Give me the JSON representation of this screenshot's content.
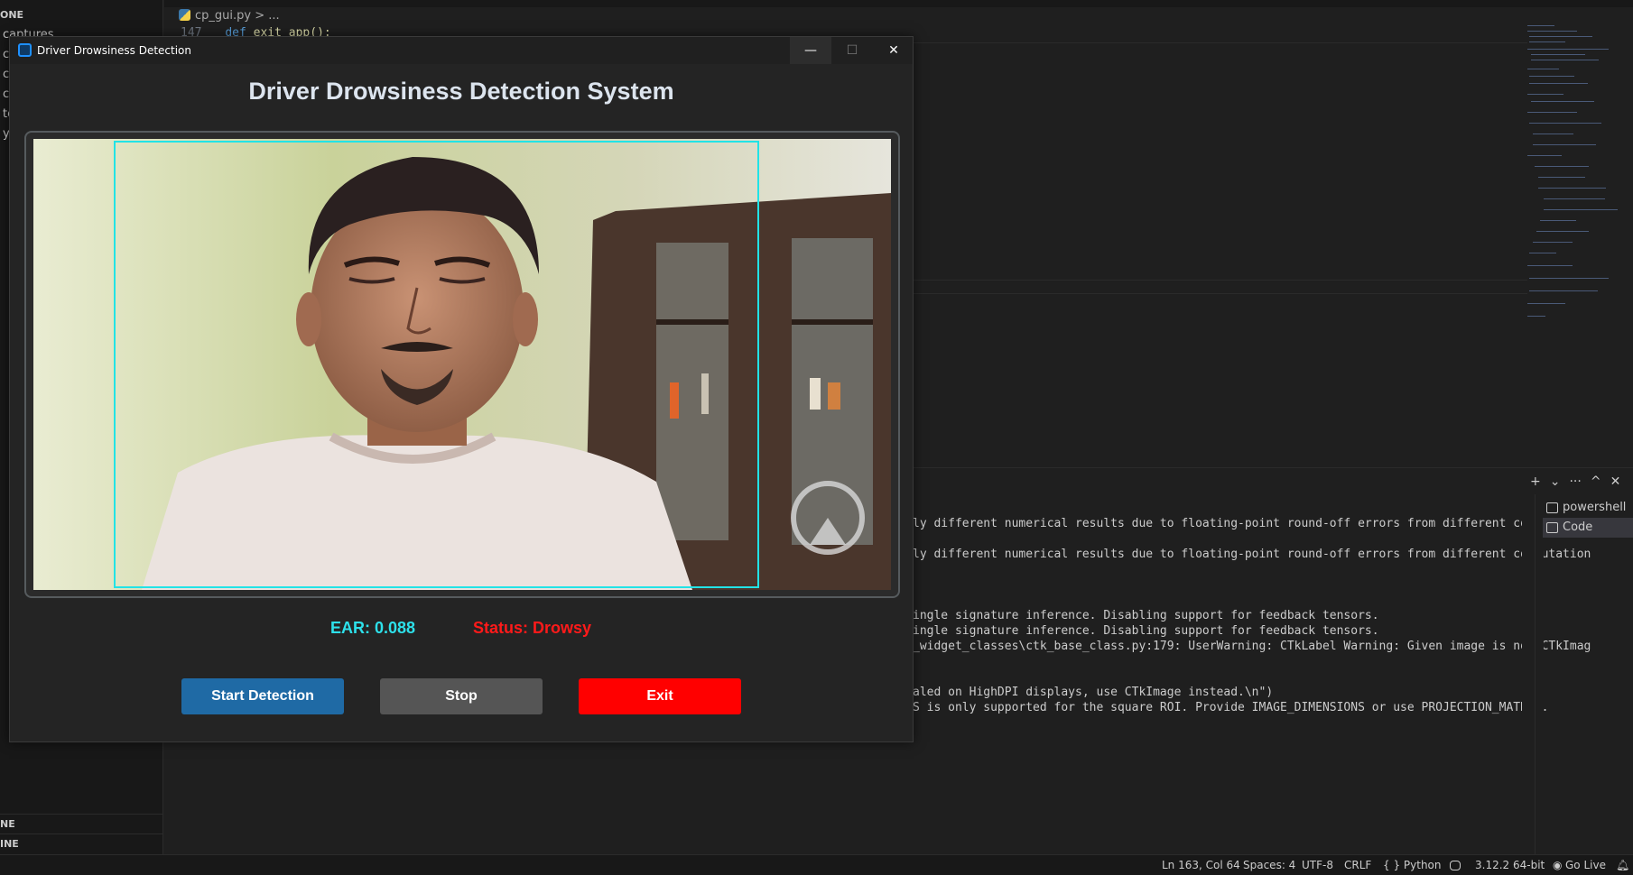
{
  "vscode": {
    "explorer": {
      "section_top": "ONE",
      "items": [
        "captures",
        "c",
        "c",
        "c",
        "te",
        "y"
      ],
      "section_bottom_1": "NE",
      "section_bottom_2": "INE"
    },
    "breadcrumb": {
      "file": "cp_gui.py",
      "sep": ">",
      "rest": "..."
    },
    "code": {
      "line_no": "147",
      "keyword": "def",
      "fn": "exit_app():"
    },
    "terminal": {
      "lines": [
        "ly different numerical results due to floating-point round-off errors from different computation",
        "ly different numerical results due to floating-point round-off errors from different computation",
        "ingle signature inference. Disabling support for feedback tensors.",
        "ingle signature inference. Disabling support for feedback tensors.",
        "_widget_classes\\ctk_base_class.py:179: UserWarning: CTkLabel Warning: Given image is not CTkImag",
        "aled on HighDPI displays, use CTkImage instead.\\n\")",
        "S is only supported for the square ROI. Provide IMAGE_DIMENSIONS or use PROJECTION_MATRIX."
      ],
      "actions": [
        "+",
        "⌄",
        "···",
        "^",
        "✕"
      ],
      "sessions": [
        {
          "name": "powershell",
          "active": false
        },
        {
          "name": "Code",
          "active": true
        }
      ]
    },
    "statusbar": {
      "position": "Ln 163, Col 64",
      "spaces": "Spaces: 4",
      "encoding": "UTF-8",
      "eol": "CRLF",
      "language": "{ } Python",
      "interpreter": "3.12.2 64-bit",
      "golive": "Go Live"
    }
  },
  "app": {
    "window_title": "Driver Drowsiness Detection",
    "controls": {
      "minimize": "—",
      "maximize": "☐",
      "close": "✕"
    },
    "heading": "Driver Drowsiness Detection System",
    "ear_text": "EAR: 0.088",
    "status_text": "Status: Drowsy",
    "buttons": {
      "start": "Start Detection",
      "stop": "Stop",
      "exit": "Exit"
    },
    "colors": {
      "ear": "#2de0ea",
      "status": "#ff1a1a",
      "start": "#1f6aa5",
      "stop": "#555555",
      "exit": "#ff0000",
      "face_box": "#22e3e6"
    },
    "video": {
      "content": "webcam-frame",
      "detection_box": "face-bounding-box"
    }
  }
}
